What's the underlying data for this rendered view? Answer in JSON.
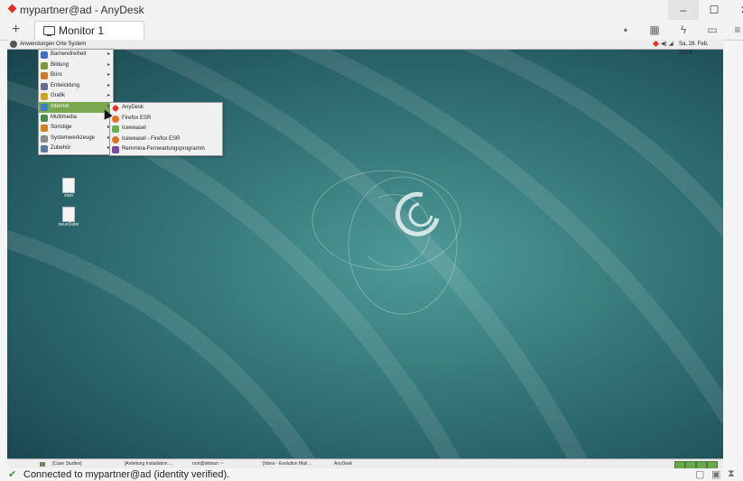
{
  "window": {
    "title": "mypartner@ad - AnyDesk",
    "minimize": "–",
    "maximize": "☐",
    "close": "✕"
  },
  "tabs": {
    "add": "+",
    "items": [
      {
        "label": "Monitor 1"
      }
    ]
  },
  "toolbar": [
    {
      "name": "chat-icon",
      "glyph": "▪"
    },
    {
      "name": "keyboard-icon",
      "glyph": "▦"
    },
    {
      "name": "actions-icon",
      "glyph": "ϟ"
    },
    {
      "name": "display-icon",
      "glyph": "▭"
    },
    {
      "name": "menu-icon",
      "glyph": "≡"
    }
  ],
  "remote": {
    "top_panel": {
      "menus": "Anwendungen  Orte  System",
      "clock": "Sa, 28. Feb, 23:08"
    },
    "applications_menu": [
      {
        "label": "Barrierefreiheit",
        "color": "#3b6fc4"
      },
      {
        "label": "Bildung",
        "color": "#7a9a3a"
      },
      {
        "label": "Büro",
        "color": "#c97a2a"
      },
      {
        "label": "Entwicklung",
        "color": "#6a6a9a"
      },
      {
        "label": "Grafik",
        "color": "#d4a020"
      },
      {
        "label": "Internet",
        "color": "#3b7fc4",
        "active": true
      },
      {
        "label": "Multimedia",
        "color": "#4a8a4a"
      },
      {
        "label": "Sonstige",
        "color": "#d48020"
      },
      {
        "label": "Systemwerkzeuge",
        "color": "#8a8a8a"
      },
      {
        "label": "Zubehör",
        "color": "#5a7aa0"
      }
    ],
    "internet_submenu": [
      {
        "label": "AnyDesk",
        "color": "#e0301e"
      },
      {
        "label": "Firefox ESR",
        "color": "#e07020"
      },
      {
        "label": "Iceweasel",
        "color": "#6ab04c"
      },
      {
        "label": "Iceweasel - Firefox ESR",
        "color": "#e07020"
      },
      {
        "label": "Remmina-Fernwartungsprogramm",
        "color": "#7a4aa0"
      }
    ],
    "desktop_icons": [
      {
        "label": "start"
      },
      {
        "label": "neueDatei"
      }
    ],
    "bottom_panel": {
      "tasks": [
        "[Case Studies]",
        "[Anleitung Installation ...",
        "root@debian: ~",
        "[Inbox - Evolution Mail ...",
        "AnyDesk"
      ]
    }
  },
  "status": {
    "text": "Connected to mypartner@ad (identity verified).",
    "icon": "plug-connected-icon"
  }
}
